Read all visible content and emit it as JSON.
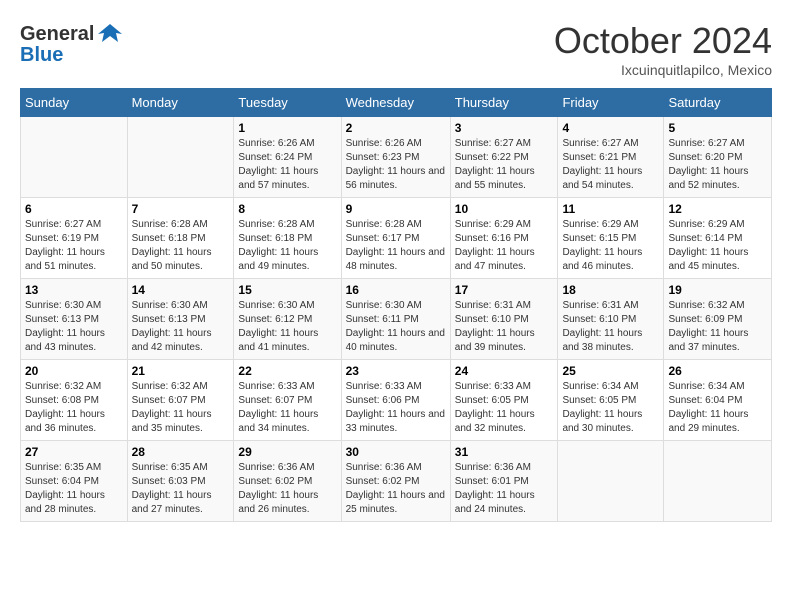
{
  "header": {
    "logo_line1": "General",
    "logo_line2": "Blue",
    "month": "October 2024",
    "location": "Ixcuinquitlapilco, Mexico"
  },
  "columns": [
    "Sunday",
    "Monday",
    "Tuesday",
    "Wednesday",
    "Thursday",
    "Friday",
    "Saturday"
  ],
  "weeks": [
    [
      {
        "day": "",
        "info": ""
      },
      {
        "day": "",
        "info": ""
      },
      {
        "day": "1",
        "info": "Sunrise: 6:26 AM\nSunset: 6:24 PM\nDaylight: 11 hours and 57 minutes."
      },
      {
        "day": "2",
        "info": "Sunrise: 6:26 AM\nSunset: 6:23 PM\nDaylight: 11 hours and 56 minutes."
      },
      {
        "day": "3",
        "info": "Sunrise: 6:27 AM\nSunset: 6:22 PM\nDaylight: 11 hours and 55 minutes."
      },
      {
        "day": "4",
        "info": "Sunrise: 6:27 AM\nSunset: 6:21 PM\nDaylight: 11 hours and 54 minutes."
      },
      {
        "day": "5",
        "info": "Sunrise: 6:27 AM\nSunset: 6:20 PM\nDaylight: 11 hours and 52 minutes."
      }
    ],
    [
      {
        "day": "6",
        "info": "Sunrise: 6:27 AM\nSunset: 6:19 PM\nDaylight: 11 hours and 51 minutes."
      },
      {
        "day": "7",
        "info": "Sunrise: 6:28 AM\nSunset: 6:18 PM\nDaylight: 11 hours and 50 minutes."
      },
      {
        "day": "8",
        "info": "Sunrise: 6:28 AM\nSunset: 6:18 PM\nDaylight: 11 hours and 49 minutes."
      },
      {
        "day": "9",
        "info": "Sunrise: 6:28 AM\nSunset: 6:17 PM\nDaylight: 11 hours and 48 minutes."
      },
      {
        "day": "10",
        "info": "Sunrise: 6:29 AM\nSunset: 6:16 PM\nDaylight: 11 hours and 47 minutes."
      },
      {
        "day": "11",
        "info": "Sunrise: 6:29 AM\nSunset: 6:15 PM\nDaylight: 11 hours and 46 minutes."
      },
      {
        "day": "12",
        "info": "Sunrise: 6:29 AM\nSunset: 6:14 PM\nDaylight: 11 hours and 45 minutes."
      }
    ],
    [
      {
        "day": "13",
        "info": "Sunrise: 6:30 AM\nSunset: 6:13 PM\nDaylight: 11 hours and 43 minutes."
      },
      {
        "day": "14",
        "info": "Sunrise: 6:30 AM\nSunset: 6:13 PM\nDaylight: 11 hours and 42 minutes."
      },
      {
        "day": "15",
        "info": "Sunrise: 6:30 AM\nSunset: 6:12 PM\nDaylight: 11 hours and 41 minutes."
      },
      {
        "day": "16",
        "info": "Sunrise: 6:30 AM\nSunset: 6:11 PM\nDaylight: 11 hours and 40 minutes."
      },
      {
        "day": "17",
        "info": "Sunrise: 6:31 AM\nSunset: 6:10 PM\nDaylight: 11 hours and 39 minutes."
      },
      {
        "day": "18",
        "info": "Sunrise: 6:31 AM\nSunset: 6:10 PM\nDaylight: 11 hours and 38 minutes."
      },
      {
        "day": "19",
        "info": "Sunrise: 6:32 AM\nSunset: 6:09 PM\nDaylight: 11 hours and 37 minutes."
      }
    ],
    [
      {
        "day": "20",
        "info": "Sunrise: 6:32 AM\nSunset: 6:08 PM\nDaylight: 11 hours and 36 minutes."
      },
      {
        "day": "21",
        "info": "Sunrise: 6:32 AM\nSunset: 6:07 PM\nDaylight: 11 hours and 35 minutes."
      },
      {
        "day": "22",
        "info": "Sunrise: 6:33 AM\nSunset: 6:07 PM\nDaylight: 11 hours and 34 minutes."
      },
      {
        "day": "23",
        "info": "Sunrise: 6:33 AM\nSunset: 6:06 PM\nDaylight: 11 hours and 33 minutes."
      },
      {
        "day": "24",
        "info": "Sunrise: 6:33 AM\nSunset: 6:05 PM\nDaylight: 11 hours and 32 minutes."
      },
      {
        "day": "25",
        "info": "Sunrise: 6:34 AM\nSunset: 6:05 PM\nDaylight: 11 hours and 30 minutes."
      },
      {
        "day": "26",
        "info": "Sunrise: 6:34 AM\nSunset: 6:04 PM\nDaylight: 11 hours and 29 minutes."
      }
    ],
    [
      {
        "day": "27",
        "info": "Sunrise: 6:35 AM\nSunset: 6:04 PM\nDaylight: 11 hours and 28 minutes."
      },
      {
        "day": "28",
        "info": "Sunrise: 6:35 AM\nSunset: 6:03 PM\nDaylight: 11 hours and 27 minutes."
      },
      {
        "day": "29",
        "info": "Sunrise: 6:36 AM\nSunset: 6:02 PM\nDaylight: 11 hours and 26 minutes."
      },
      {
        "day": "30",
        "info": "Sunrise: 6:36 AM\nSunset: 6:02 PM\nDaylight: 11 hours and 25 minutes."
      },
      {
        "day": "31",
        "info": "Sunrise: 6:36 AM\nSunset: 6:01 PM\nDaylight: 11 hours and 24 minutes."
      },
      {
        "day": "",
        "info": ""
      },
      {
        "day": "",
        "info": ""
      }
    ]
  ]
}
